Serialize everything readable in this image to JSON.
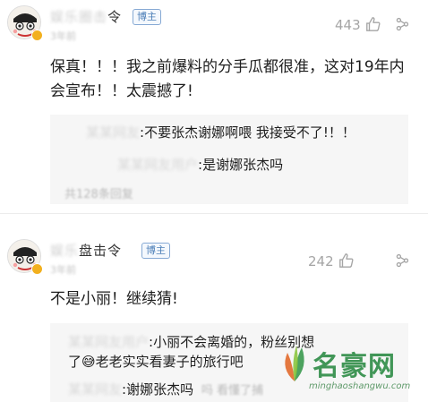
{
  "comments": [
    {
      "username_visible": "令",
      "username_hidden": "娱乐圈击",
      "badge": "博主",
      "subline": "3年前",
      "likes": "443",
      "text": "保真！！！我之前爆料的分手瓜都很准，这对19年内会宣布！！太震撼了!",
      "replies": [
        {
          "who": "某某网友",
          "text": ":不要张杰谢娜啊喂 我接受不了!！！"
        },
        {
          "who": "某某网友用户",
          "text": ":是谢娜张杰吗"
        }
      ],
      "more_replies": "共128条回复"
    },
    {
      "username_visible": "盘击令",
      "username_hidden": "娱乐",
      "badge": "博主",
      "subline": "3年前",
      "likes": "242",
      "text": "不是小丽！继续猜!",
      "replies": [
        {
          "who": "某某网友用户",
          "text": ":小丽不会离婚的，粉丝别想"
        },
        {
          "who": "",
          "text": "了😅老老实实看妻子的旅行吧"
        },
        {
          "who": "某某网友",
          "text": ":谢娜张杰吗"
        }
      ],
      "more_replies": "吗 看懂了捕"
    }
  ],
  "watermark": {
    "title": "名豪网",
    "url": "minghaoshangwu.com"
  },
  "colors": {
    "badge_blue": "#4d7fb8",
    "gold": "#f2b01e",
    "watermark_green": "#2e8c46"
  },
  "icons": [
    "avatar",
    "verified-badge-icon",
    "thumbs-up-icon",
    "more-options-icon",
    "emoji-icon",
    "leaf-logo-icon"
  ]
}
